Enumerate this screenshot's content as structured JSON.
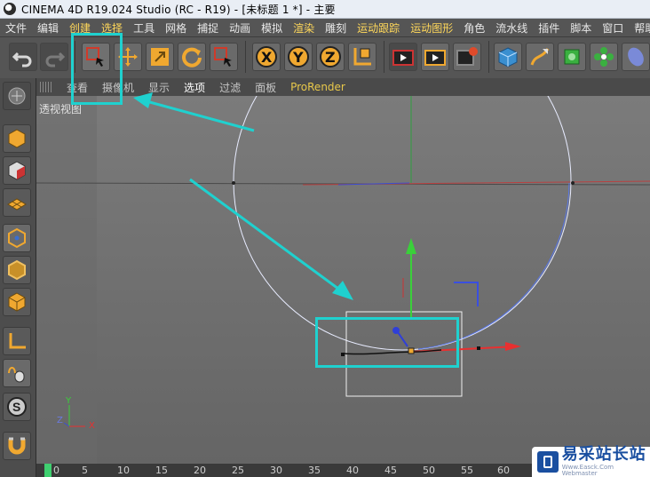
{
  "window": {
    "title": "CINEMA 4D R19.024 Studio (RC - R19) - [未标题 1 *] - 主要"
  },
  "menubar": {
    "items": [
      {
        "label": "文件"
      },
      {
        "label": "编辑"
      },
      {
        "label": "创建"
      },
      {
        "label": "选择"
      },
      {
        "label": "工具"
      },
      {
        "label": "网格"
      },
      {
        "label": "捕捉"
      },
      {
        "label": "动画"
      },
      {
        "label": "模拟"
      },
      {
        "label": "渲染"
      },
      {
        "label": "雕刻"
      },
      {
        "label": "运动跟踪"
      },
      {
        "label": "运动图形"
      },
      {
        "label": "角色"
      },
      {
        "label": "流水线"
      },
      {
        "label": "插件"
      },
      {
        "label": "脚本"
      },
      {
        "label": "窗口"
      },
      {
        "label": "帮助"
      }
    ]
  },
  "toolbar": {
    "axis_x": "X",
    "axis_y": "Y",
    "axis_z": "Z"
  },
  "viewport_menu": {
    "items": [
      {
        "label": "查看"
      },
      {
        "label": "摄像机"
      },
      {
        "label": "显示"
      },
      {
        "label": "选项"
      },
      {
        "label": "过滤"
      },
      {
        "label": "面板"
      },
      {
        "label": "ProRender"
      }
    ],
    "view_label": "透视视图"
  },
  "axis_gizmo": {
    "y": "Y",
    "z": "Z",
    "x": "X"
  },
  "timeline": {
    "ticks": [
      "0",
      "5",
      "10",
      "15",
      "20",
      "25",
      "30",
      "35",
      "40",
      "45",
      "50",
      "55",
      "60"
    ],
    "current_frame": 0
  },
  "watermark": {
    "title": "易采站长站",
    "subtitle": "Www.Easck.Com Webmaster"
  },
  "colors": {
    "highlight": "#1fd1cf",
    "axis_x": "#e83030",
    "axis_y": "#30d030",
    "axis_z": "#2f3fd8",
    "viewport_bg": "#6f6f6f"
  }
}
